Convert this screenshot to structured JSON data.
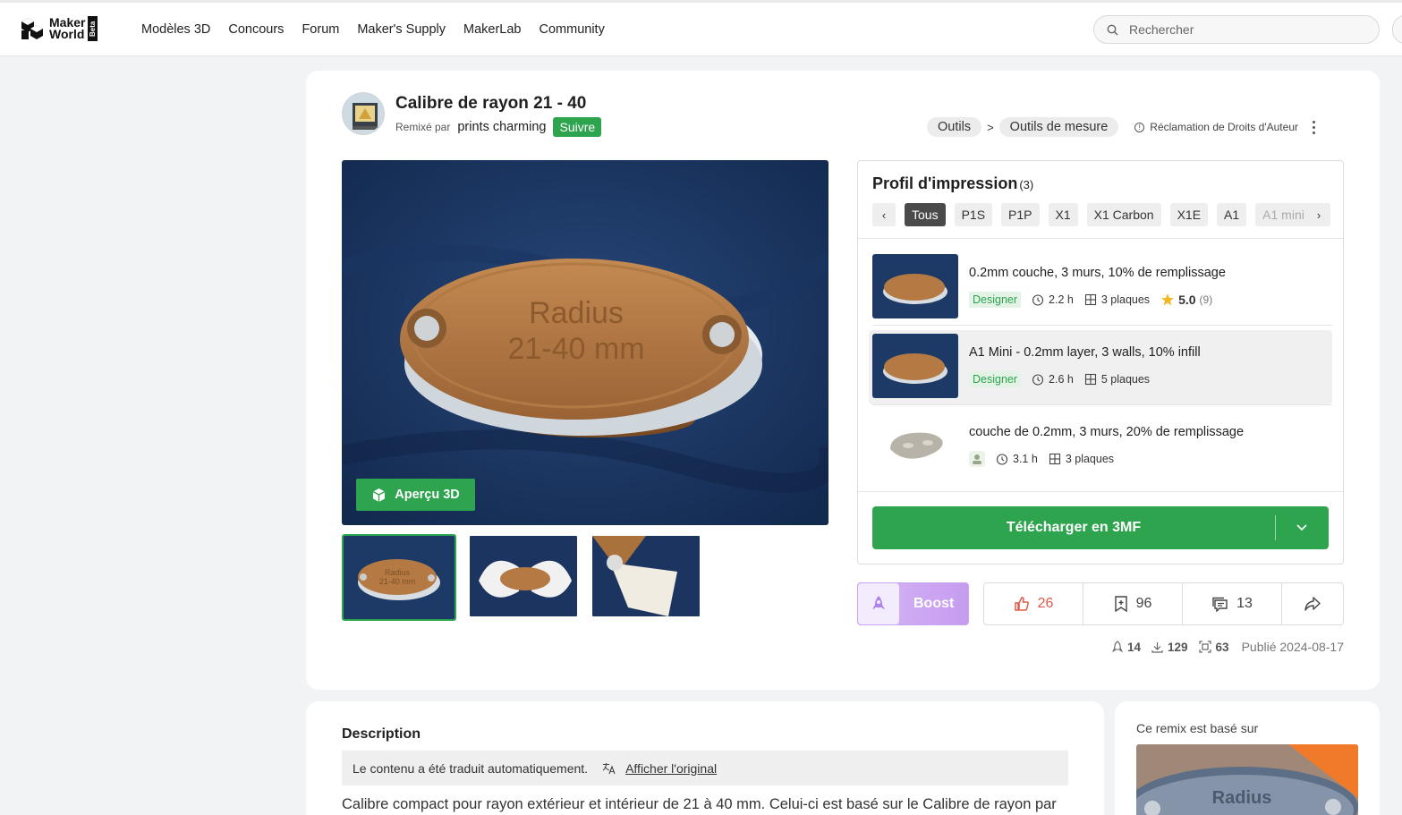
{
  "header": {
    "logo_top": "Maker",
    "logo_bottom": "World",
    "logo_badge": "Beta",
    "nav": [
      "Modèles 3D",
      "Concours",
      "Forum",
      "Maker's Supply",
      "MakerLab",
      "Community"
    ],
    "search_placeholder": "Rechercher"
  },
  "model": {
    "title": "Calibre de rayon 21 - 40",
    "remixed_by_label": "Remixé par",
    "author": "prints charming",
    "follow_label": "Suivre",
    "breadcrumb": [
      "Outils",
      "Outils de mesure"
    ],
    "breadcrumb_sep": ">",
    "claim_label": "Réclamation de Droits d'Auteur",
    "preview_3d_label": "Aperçu 3D",
    "hero_text": [
      "Radius",
      "21-40 mm"
    ],
    "thumb_text": [
      "Radius",
      "21-40 mm"
    ]
  },
  "profile": {
    "title": "Profil d'impression",
    "count": "(3)",
    "filters": [
      "Tous",
      "P1S",
      "P1P",
      "X1",
      "X1 Carbon",
      "X1E",
      "A1",
      "A1 mini"
    ],
    "active_filter": "Tous",
    "items": [
      {
        "name": "0.2mm couche, 3 murs, 10% de remplissage",
        "badge": "Designer",
        "time": "2.2 h",
        "plates": "3 plaques",
        "rating": "5.0",
        "rating_count": "(9)"
      },
      {
        "name": "A1 Mini - 0.2mm layer, 3 walls, 10% infill",
        "badge": "Designer",
        "time": "2.6 h",
        "plates": "5 plaques"
      },
      {
        "name": "couche de 0.2mm, 3 murs, 20% de remplissage",
        "time": "3.1 h",
        "plates": "3 plaques"
      }
    ],
    "download_label": "Télécharger en 3MF"
  },
  "actions": {
    "boost_label": "Boost",
    "likes": "26",
    "collects": "96",
    "comments": "13"
  },
  "stats": {
    "boosts": "14",
    "downloads": "129",
    "prints": "63",
    "published": "Publié 2024-08-17"
  },
  "description": {
    "heading": "Description",
    "translated_notice": "Le contenu a été traduit automatiquement.",
    "show_original": "Afficher l'original",
    "text": "Calibre compact pour rayon extérieur et intérieur de 21 à 40 mm. Celui-ci est basé sur le Calibre de rayon par"
  },
  "remix": {
    "label": "Ce remix est basé sur",
    "image_text": "Radius"
  },
  "colors": {
    "accent": "#2ea44f",
    "like": "#e05a4a",
    "boost": "#c59cf0"
  }
}
